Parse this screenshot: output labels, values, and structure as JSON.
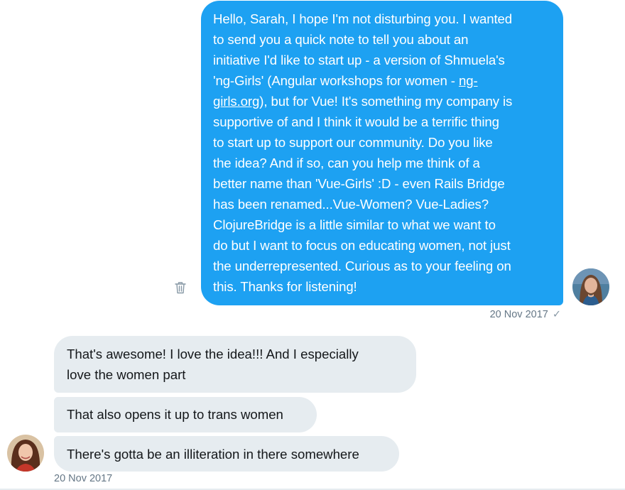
{
  "messages": {
    "sent": {
      "text_before_link": "Hello, Sarah, I hope I'm not disturbing you. I wanted\nto send you a quick note to tell you about an\ninitiative I'd like to start up - a version of Shmuela's\n'ng-Girls' (Angular workshops for women - ",
      "link_text": "ng-\ngirls.org",
      "text_after_link": "), but for Vue! It's something my company is\nsupportive of and I think it would be a terrific thing\nto start up to support our community. Do you like\nthe idea? And if so, can you help me think of a\nbetter name than 'Vue-Girls' :D - even Rails Bridge\nhas been renamed...Vue-Women? Vue-Ladies?\nClojureBridge is a little similar to what we want to\ndo but I want to focus on educating women, not just\nthe underrepresented. Curious as to your feeling on\nthis. Thanks for listening!",
      "timestamp": "20 Nov 2017",
      "status_icon": "checkmark-icon"
    },
    "received": [
      {
        "text": "That's awesome! I love the idea!!! And I especially\nlove the women part"
      },
      {
        "text": "That also opens it up to trans women"
      },
      {
        "text": "There's gotta be an illiteration in there somewhere"
      }
    ],
    "received_timestamp": "20 Nov 2017"
  },
  "colors": {
    "sent_bubble": "#1da1f2",
    "received_bubble": "#e6ecf0",
    "meta_text": "#657786"
  }
}
